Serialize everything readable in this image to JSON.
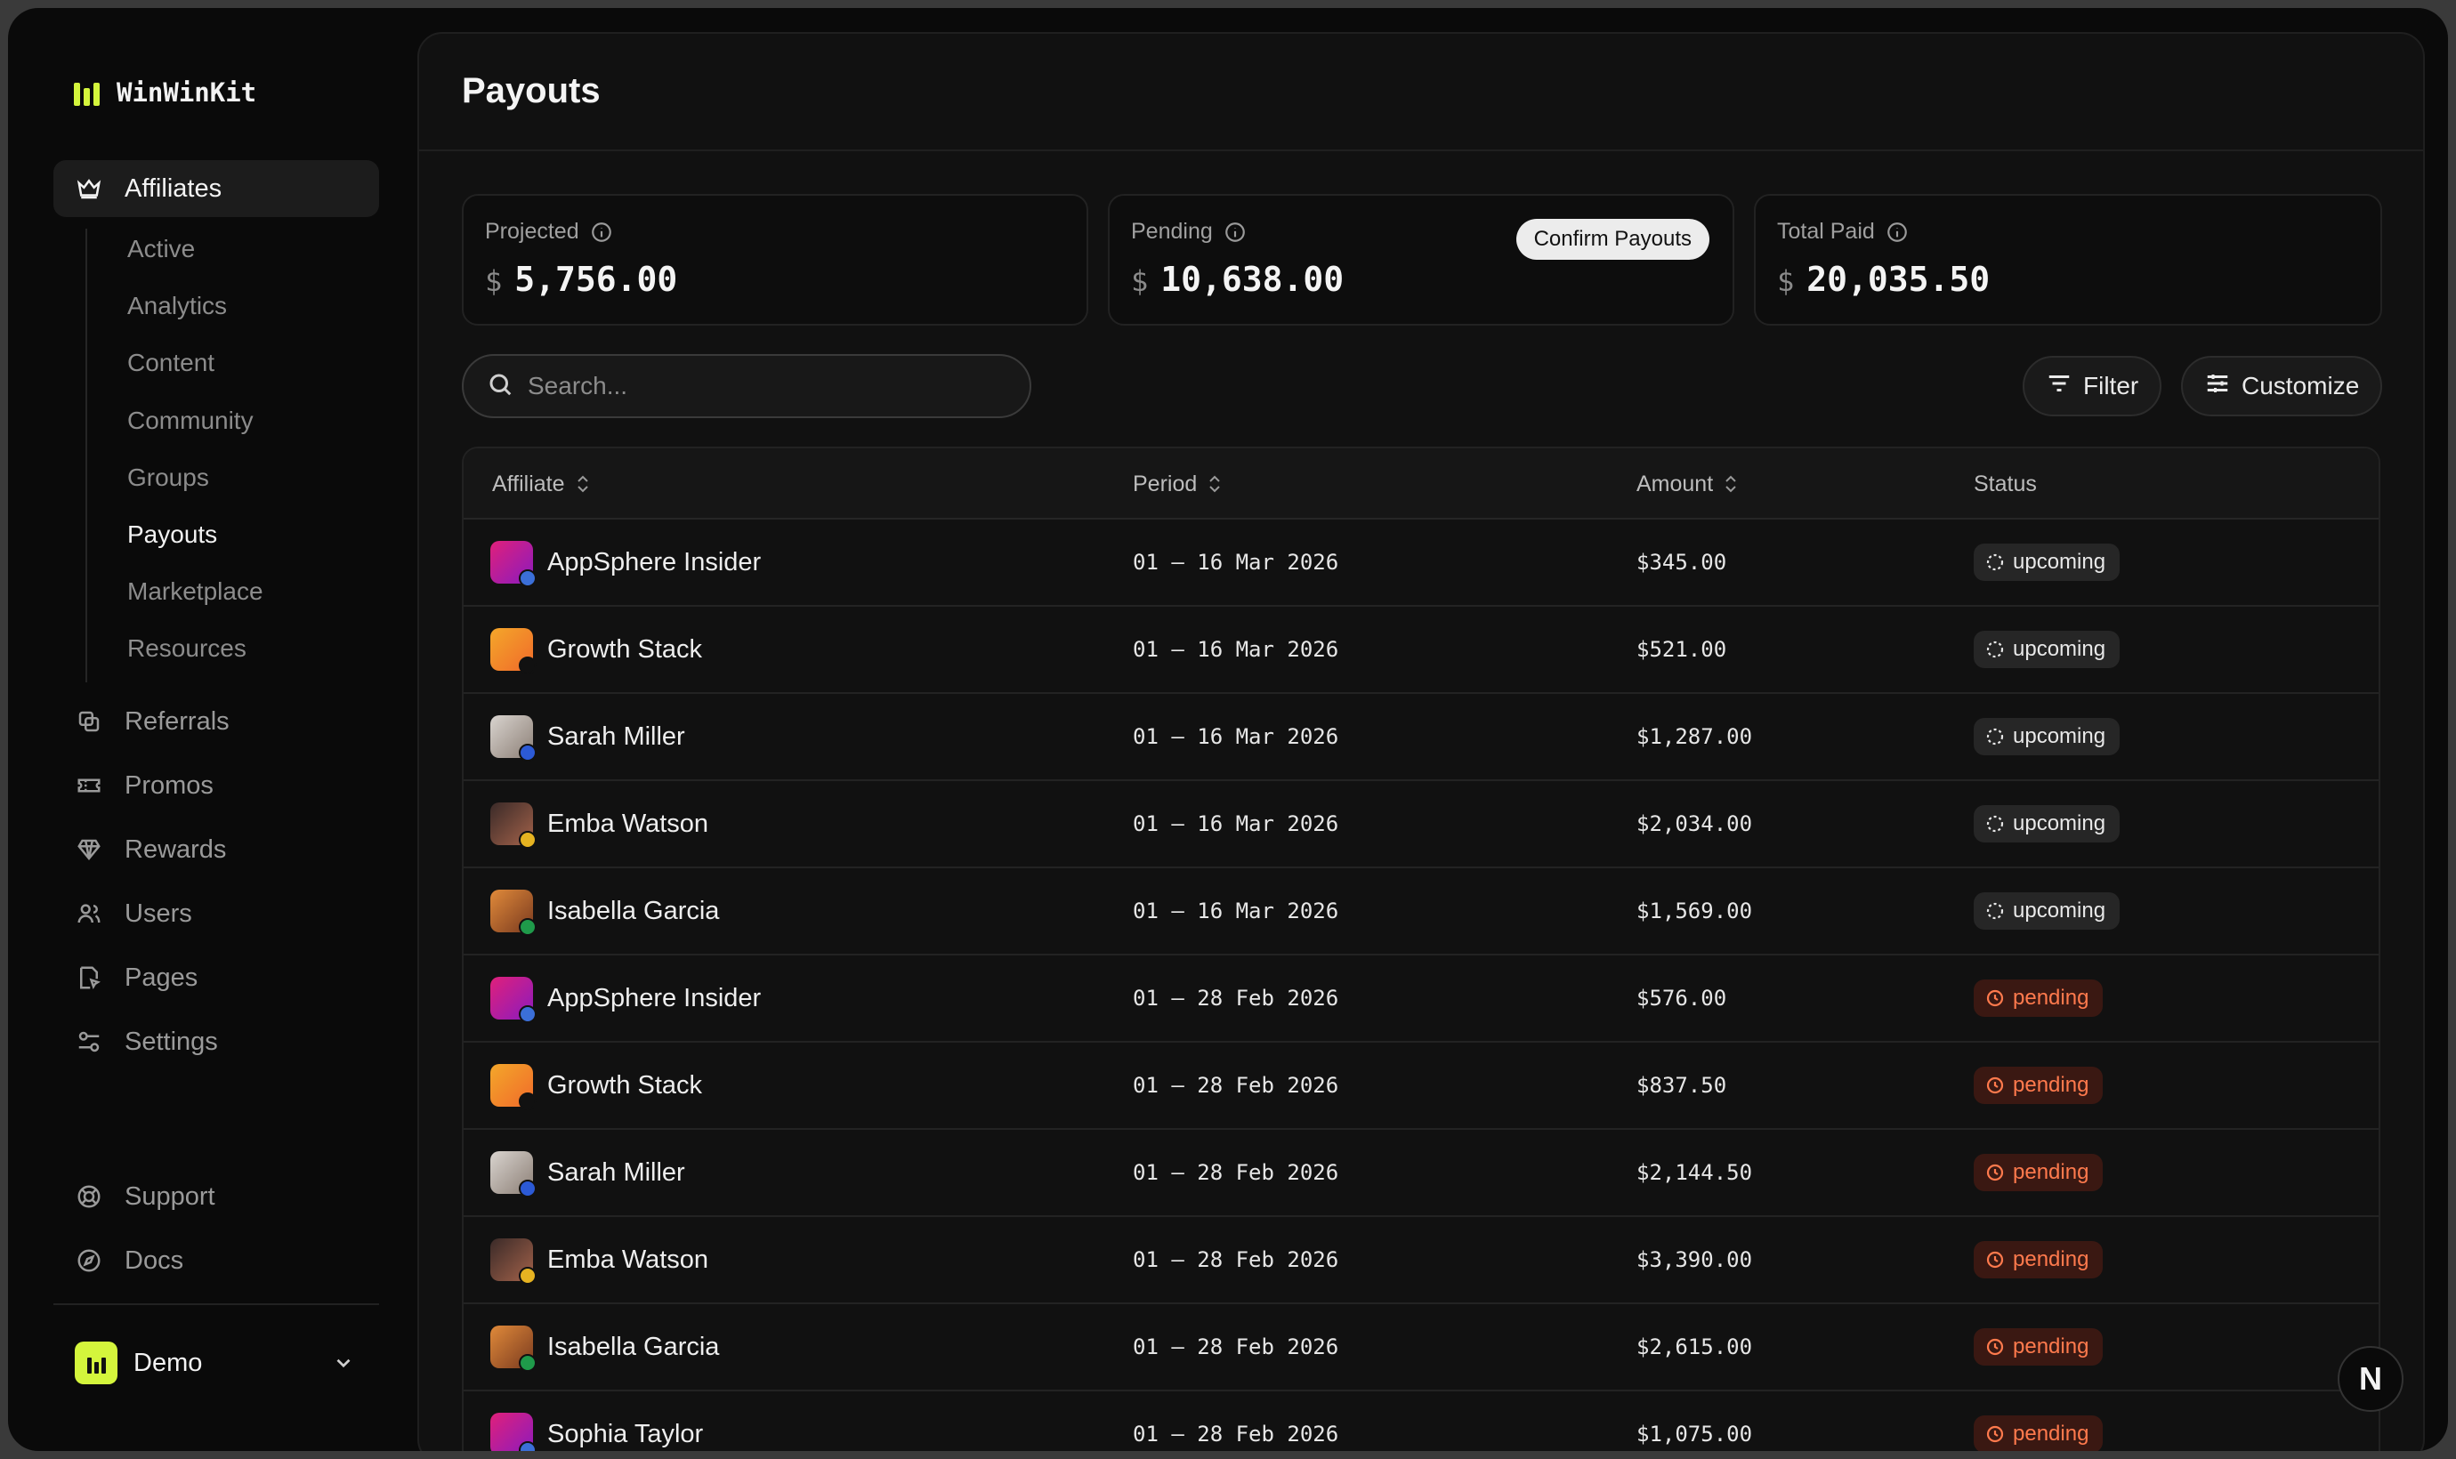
{
  "app": {
    "name": "WinWinKit"
  },
  "sidebar": {
    "main": {
      "label": "Affiliates",
      "icon": "crown-icon"
    },
    "sub": [
      "Active",
      "Analytics",
      "Content",
      "Community",
      "Groups",
      "Payouts",
      "Marketplace",
      "Resources"
    ],
    "items": [
      {
        "label": "Referrals",
        "icon": "referrals-icon"
      },
      {
        "label": "Promos",
        "icon": "ticket-icon"
      },
      {
        "label": "Rewards",
        "icon": "diamond-icon"
      },
      {
        "label": "Users",
        "icon": "users-icon"
      },
      {
        "label": "Pages",
        "icon": "page-icon"
      },
      {
        "label": "Settings",
        "icon": "sliders-icon"
      }
    ],
    "footer": [
      {
        "label": "Support",
        "icon": "lifebuoy-icon"
      },
      {
        "label": "Docs",
        "icon": "compass-icon"
      }
    ],
    "workspace": {
      "name": "Demo"
    }
  },
  "page": {
    "title": "Payouts"
  },
  "stats": {
    "projected": {
      "label": "Projected",
      "currency": "$",
      "value": "5,756.00"
    },
    "pending": {
      "label": "Pending",
      "currency": "$",
      "value": "10,638.00",
      "action": "Confirm Payouts"
    },
    "total_paid": {
      "label": "Total Paid",
      "currency": "$",
      "value": "20,035.50"
    }
  },
  "toolbar": {
    "search_placeholder": "Search...",
    "filter": "Filter",
    "customize": "Customize"
  },
  "table": {
    "columns": [
      "Affiliate",
      "Period",
      "Amount",
      "Status"
    ],
    "rows": [
      {
        "affiliate": "AppSphere Insider",
        "period": "01 – 16 Mar 2026",
        "amount": "$345.00",
        "status": "upcoming"
      },
      {
        "affiliate": "Growth Stack",
        "period": "01 – 16 Mar 2026",
        "amount": "$521.00",
        "status": "upcoming"
      },
      {
        "affiliate": "Sarah Miller",
        "period": "01 – 16 Mar 2026",
        "amount": "$1,287.00",
        "status": "upcoming"
      },
      {
        "affiliate": "Emba Watson",
        "period": "01 – 16 Mar 2026",
        "amount": "$2,034.00",
        "status": "upcoming"
      },
      {
        "affiliate": "Isabella Garcia",
        "period": "01 – 16 Mar 2026",
        "amount": "$1,569.00",
        "status": "upcoming"
      },
      {
        "affiliate": "AppSphere Insider",
        "period": "01 – 28 Feb 2026",
        "amount": "$576.00",
        "status": "pending"
      },
      {
        "affiliate": "Growth Stack",
        "period": "01 – 28 Feb 2026",
        "amount": "$837.50",
        "status": "pending"
      },
      {
        "affiliate": "Sarah Miller",
        "period": "01 – 28 Feb 2026",
        "amount": "$2,144.50",
        "status": "pending"
      },
      {
        "affiliate": "Emba Watson",
        "period": "01 – 28 Feb 2026",
        "amount": "$3,390.00",
        "status": "pending"
      },
      {
        "affiliate": "Isabella Garcia",
        "period": "01 – 28 Feb 2026",
        "amount": "$2,615.00",
        "status": "pending"
      },
      {
        "affiliate": "Sophia Taylor",
        "period": "01 – 28 Feb 2026",
        "amount": "$1,075.00",
        "status": "pending"
      }
    ]
  },
  "colors": {
    "accent": "#d4f53c",
    "pending": "#ff7a4d",
    "pending_bg": "#3a1812"
  },
  "fab": {
    "label": "N"
  }
}
